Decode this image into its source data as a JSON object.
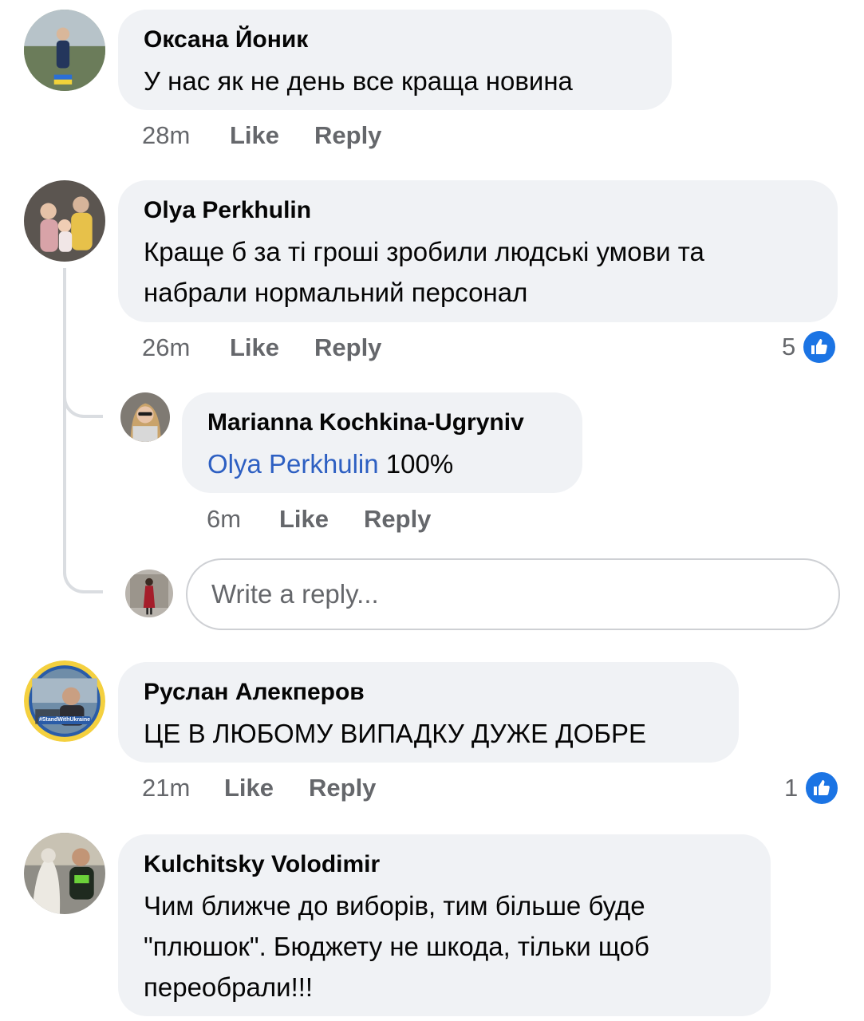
{
  "comments": [
    {
      "author": "Оксана Йоник",
      "text": "У нас як не день все краща новина",
      "time": "28m",
      "like_label": "Like",
      "reply_label": "Reply"
    },
    {
      "author": "Olya Perkhulin",
      "text_line1": "Краще б за ті гроші зробили людські умови та",
      "text_line2": "набрали нормальний персонал",
      "time": "26m",
      "like_label": "Like",
      "reply_label": "Reply",
      "reaction_count": "5",
      "replies": [
        {
          "author": "Marianna Kochkina-Ugryniv",
          "mention": "Olya Perkhulin",
          "text": " 100%",
          "time": "6m",
          "like_label": "Like",
          "reply_label": "Reply"
        }
      ],
      "reply_input_placeholder": "Write a reply..."
    },
    {
      "author": "Руслан Алекперов",
      "text": "ЦЕ В ЛЮБОМУ ВИПАДКУ ДУЖЕ ДОБРЕ",
      "time": "21m",
      "like_label": "Like",
      "reply_label": "Reply",
      "reaction_count": "1",
      "avatar_badge": "#StandWithUkraine"
    },
    {
      "author": "Kulchitsky Volodimir",
      "text_line1": "Чим ближче до виборів, тим більше буде",
      "text_line2": "\"плюшок\". Бюджету не шкода, тільки щоб",
      "text_line3": "переобрали!!!"
    }
  ],
  "colors": {
    "bubble": "#f0f2f5",
    "meta_text": "#65676b",
    "mention": "#2d5fc2",
    "like_blue": "#1b74e4"
  },
  "icons": [
    "like-thumb-icon"
  ]
}
